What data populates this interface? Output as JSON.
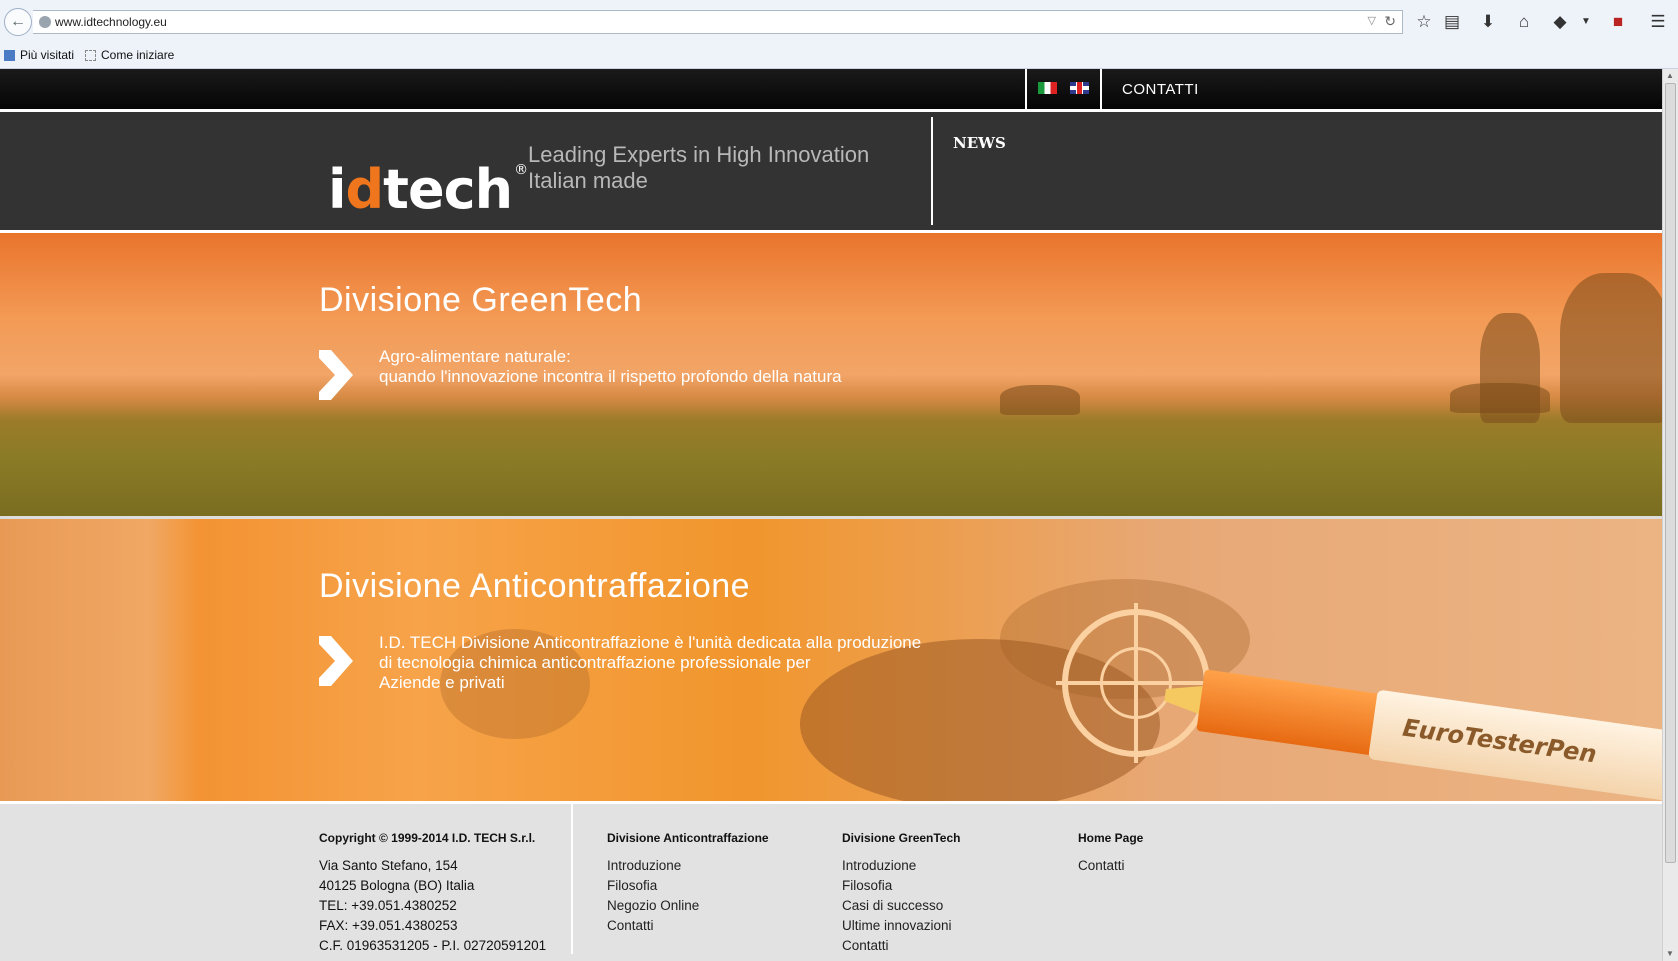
{
  "browser": {
    "url": "www.idtechnology.eu",
    "bookmarks": [
      "Più visitati",
      "Come iniziare"
    ]
  },
  "site": {
    "lang_flags": [
      "italian-flag",
      "english-flag"
    ],
    "contact_link": "CONTATTI",
    "logo": {
      "prefix": "i",
      "highlight": "d",
      "suffix": "tech",
      "mark": "®"
    },
    "tagline": [
      "Leading Experts in High Innovation",
      "Italian made"
    ],
    "news_title": "NEWS"
  },
  "greentech": {
    "title": "Divisione GreenTech",
    "text": [
      "Agro-alimentare naturale:",
      "quando l'innovazione incontra il rispetto profondo della natura"
    ]
  },
  "anticontraffazione": {
    "title": "Divisione Anticontraffazione",
    "text": [
      "I.D. TECH Divisione Anticontraffazione è l'unità dedicata alla produzione",
      "di tecnologia chimica anticontraffazione professionale per",
      "Aziende e privati"
    ],
    "product_brand": "EuroTesterPen"
  },
  "footer": {
    "copyright_prefix": "Copyright © 1999-2014",
    "company": "I.D. TECH",
    "company_suffix": "S.r.l.",
    "address": [
      "Via Santo Stefano, 154",
      "40125 Bologna (BO) Italia",
      "TEL: +39.051.4380252",
      "FAX: +39.051.4380253",
      "C.F. 01963531205 - P.I. 02720591201"
    ],
    "col_anti": {
      "head": "Divisione Anticontraffazione",
      "links": [
        "Introduzione",
        "Filosofia",
        "Negozio Online",
        "Contatti"
      ]
    },
    "col_green": {
      "head": "Divisione GreenTech",
      "links": [
        "Introduzione",
        "Filosofia",
        "Casi di successo",
        "Ultime innovazioni",
        "Contatti"
      ]
    },
    "col_home": {
      "head": "Home Page",
      "links": [
        "Contatti"
      ]
    }
  },
  "colors": {
    "accent": "#f0761d",
    "header_bg": "#333333",
    "footer_bg": "#e2e2e2"
  }
}
